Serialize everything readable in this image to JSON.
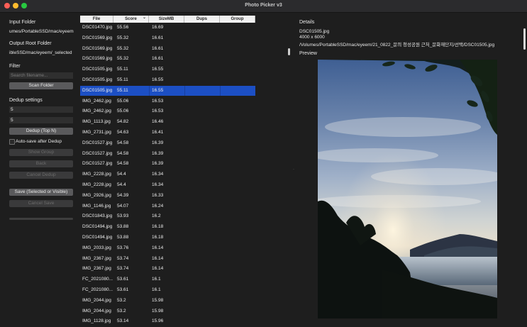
{
  "window": {
    "title": "Photo Picker v3"
  },
  "left": {
    "input_label": "Input Folder",
    "input_path": "umes/PortableSSD/mac/eyeem",
    "output_label": "Output Root Folder",
    "output_path": "ibleSSD/mac/eyeem/_selected",
    "filter_label": "Filter",
    "filter_placeholder": "Search filename...",
    "scan_button": "Scan Folder",
    "dedup_label": "Dedup settings",
    "dedup_value1": "5",
    "dedup_value2": "5",
    "dedup_button": "Dedup (Top N)",
    "autosave_label": "Auto-save after Dedup",
    "show_group_button": "Show Group",
    "back_button": "Back",
    "cancel_dedup_button": "Cancel Dedup",
    "save_button": "Save (Selected or Visible)",
    "cancel_save_button": "Cancel Save"
  },
  "table": {
    "columns": [
      "File",
      "Score",
      "SizeMB",
      "Dups",
      "Group"
    ],
    "sort_indicator": "⌄",
    "selected_index": 6,
    "rows": [
      {
        "file": "DSC01470.jpg",
        "score": "55.56",
        "size": "16.69"
      },
      {
        "file": "DSC01569.jpg",
        "score": "55.32",
        "size": "16.61"
      },
      {
        "file": "DSC01569.jpg",
        "score": "55.32",
        "size": "16.61"
      },
      {
        "file": "DSC01569.jpg",
        "score": "55.32",
        "size": "16.61"
      },
      {
        "file": "DSC01505.jpg",
        "score": "55.11",
        "size": "16.55"
      },
      {
        "file": "DSC01505.jpg",
        "score": "55.11",
        "size": "16.55"
      },
      {
        "file": "DSC01505.jpg",
        "score": "55.11",
        "size": "16.55"
      },
      {
        "file": "IMG_2462.jpg",
        "score": "55.06",
        "size": "16.53"
      },
      {
        "file": "IMG_2462.jpg",
        "score": "55.06",
        "size": "16.53"
      },
      {
        "file": "IMG_1113.jpg",
        "score": "54.82",
        "size": "16.46"
      },
      {
        "file": "IMG_2731.jpg",
        "score": "54.63",
        "size": "16.41"
      },
      {
        "file": "DSC01527.jpg",
        "score": "54.58",
        "size": "16.39"
      },
      {
        "file": "DSC01527.jpg",
        "score": "54.58",
        "size": "16.39"
      },
      {
        "file": "DSC01527.jpg",
        "score": "54.58",
        "size": "16.39"
      },
      {
        "file": "IMG_2228.jpg",
        "score": "54.4",
        "size": "16.34"
      },
      {
        "file": "IMG_2228.jpg",
        "score": "54.4",
        "size": "16.34"
      },
      {
        "file": "IMG_2926.jpg",
        "score": "54.39",
        "size": "16.33"
      },
      {
        "file": "IMG_1146.jpg",
        "score": "54.07",
        "size": "16.24"
      },
      {
        "file": "DSC01843.jpg",
        "score": "53.93",
        "size": "16.2"
      },
      {
        "file": "DSC01494.jpg",
        "score": "53.88",
        "size": "16.18"
      },
      {
        "file": "DSC01494.jpg",
        "score": "53.88",
        "size": "16.18"
      },
      {
        "file": "IMG_2033.jpg",
        "score": "53.76",
        "size": "16.14"
      },
      {
        "file": "IMG_2367.jpg",
        "score": "53.74",
        "size": "16.14"
      },
      {
        "file": "IMG_2367.jpg",
        "score": "53.74",
        "size": "16.14"
      },
      {
        "file": "FC_2021080...",
        "score": "53.61",
        "size": "16.1"
      },
      {
        "file": "FC_2021080...",
        "score": "53.61",
        "size": "16.1"
      },
      {
        "file": "IMG_2044.jpg",
        "score": "53.2",
        "size": "15.98"
      },
      {
        "file": "IMG_2044.jpg",
        "score": "53.2",
        "size": "15.98"
      },
      {
        "file": "IMG_1128.jpg",
        "score": "53.14",
        "size": "15.96"
      }
    ]
  },
  "details": {
    "label": "Details",
    "filename": "DSC01505.jpg",
    "dimensions": "4000 x 6000",
    "path": "/Volumes/PortableSSD/mac/eyeem/21_0822_문의 청성공원 근처_문화재단지/선택/DSC01505.jpg",
    "preview_label": "Preview"
  },
  "colors": {
    "selection": "#1c4fc4",
    "window_bg": "#1e1e1e",
    "button": "#5a5a5c",
    "button_disabled": "#3a3a3b"
  }
}
